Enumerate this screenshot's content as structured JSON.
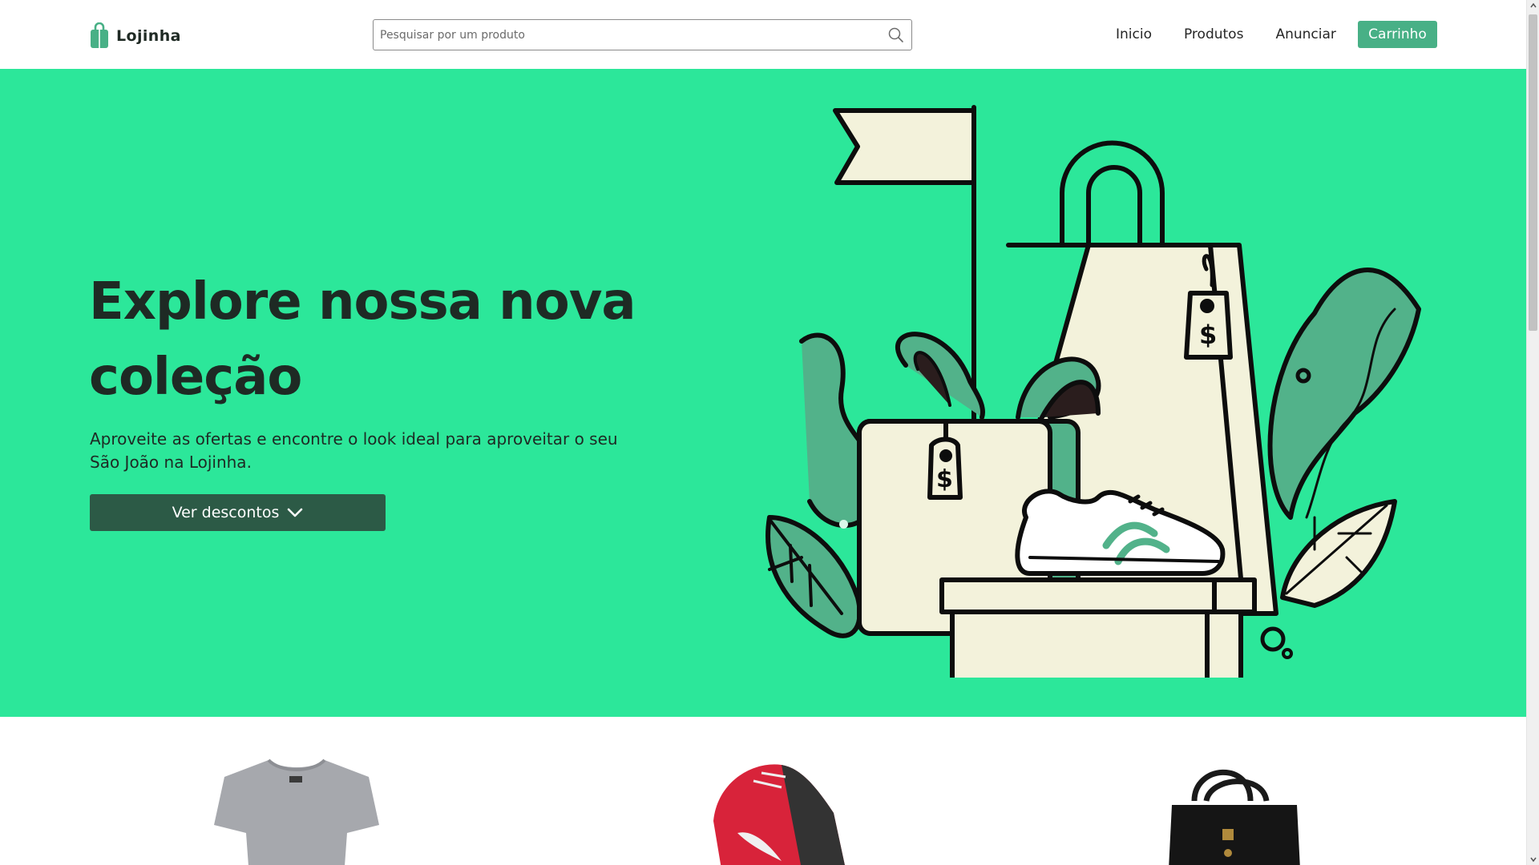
{
  "brand": {
    "name": "Lojinha",
    "icon": "shopping-bag-icon"
  },
  "search": {
    "placeholder": "Pesquisar por um produto",
    "value": "",
    "icon": "search-icon"
  },
  "nav": {
    "links": [
      "Inicio",
      "Produtos",
      "Anunciar"
    ],
    "cart_label": "Carrinho"
  },
  "hero": {
    "title": "Explore nossa nova coleção",
    "description": "Aproveite as ofertas e encontre o look ideal para aproveitar o seu São João na Lojinha.",
    "button_label": "Ver descontos",
    "button_icon": "chevron-down-icon",
    "illustration": "shopping-illustration"
  },
  "products": [
    {
      "name": "t-shirt",
      "image": "gray-tshirt"
    },
    {
      "name": "sneaker",
      "image": "red-sneaker"
    },
    {
      "name": "handbag",
      "image": "black-handbag"
    }
  ],
  "colors": {
    "accent": "#48b086",
    "hero_bg": "#2ce79a",
    "hero_button": "#2c5a46",
    "text_dark": "#1e2a24",
    "illustration_cream": "#f3f2db",
    "illustration_green": "#52b28a"
  }
}
